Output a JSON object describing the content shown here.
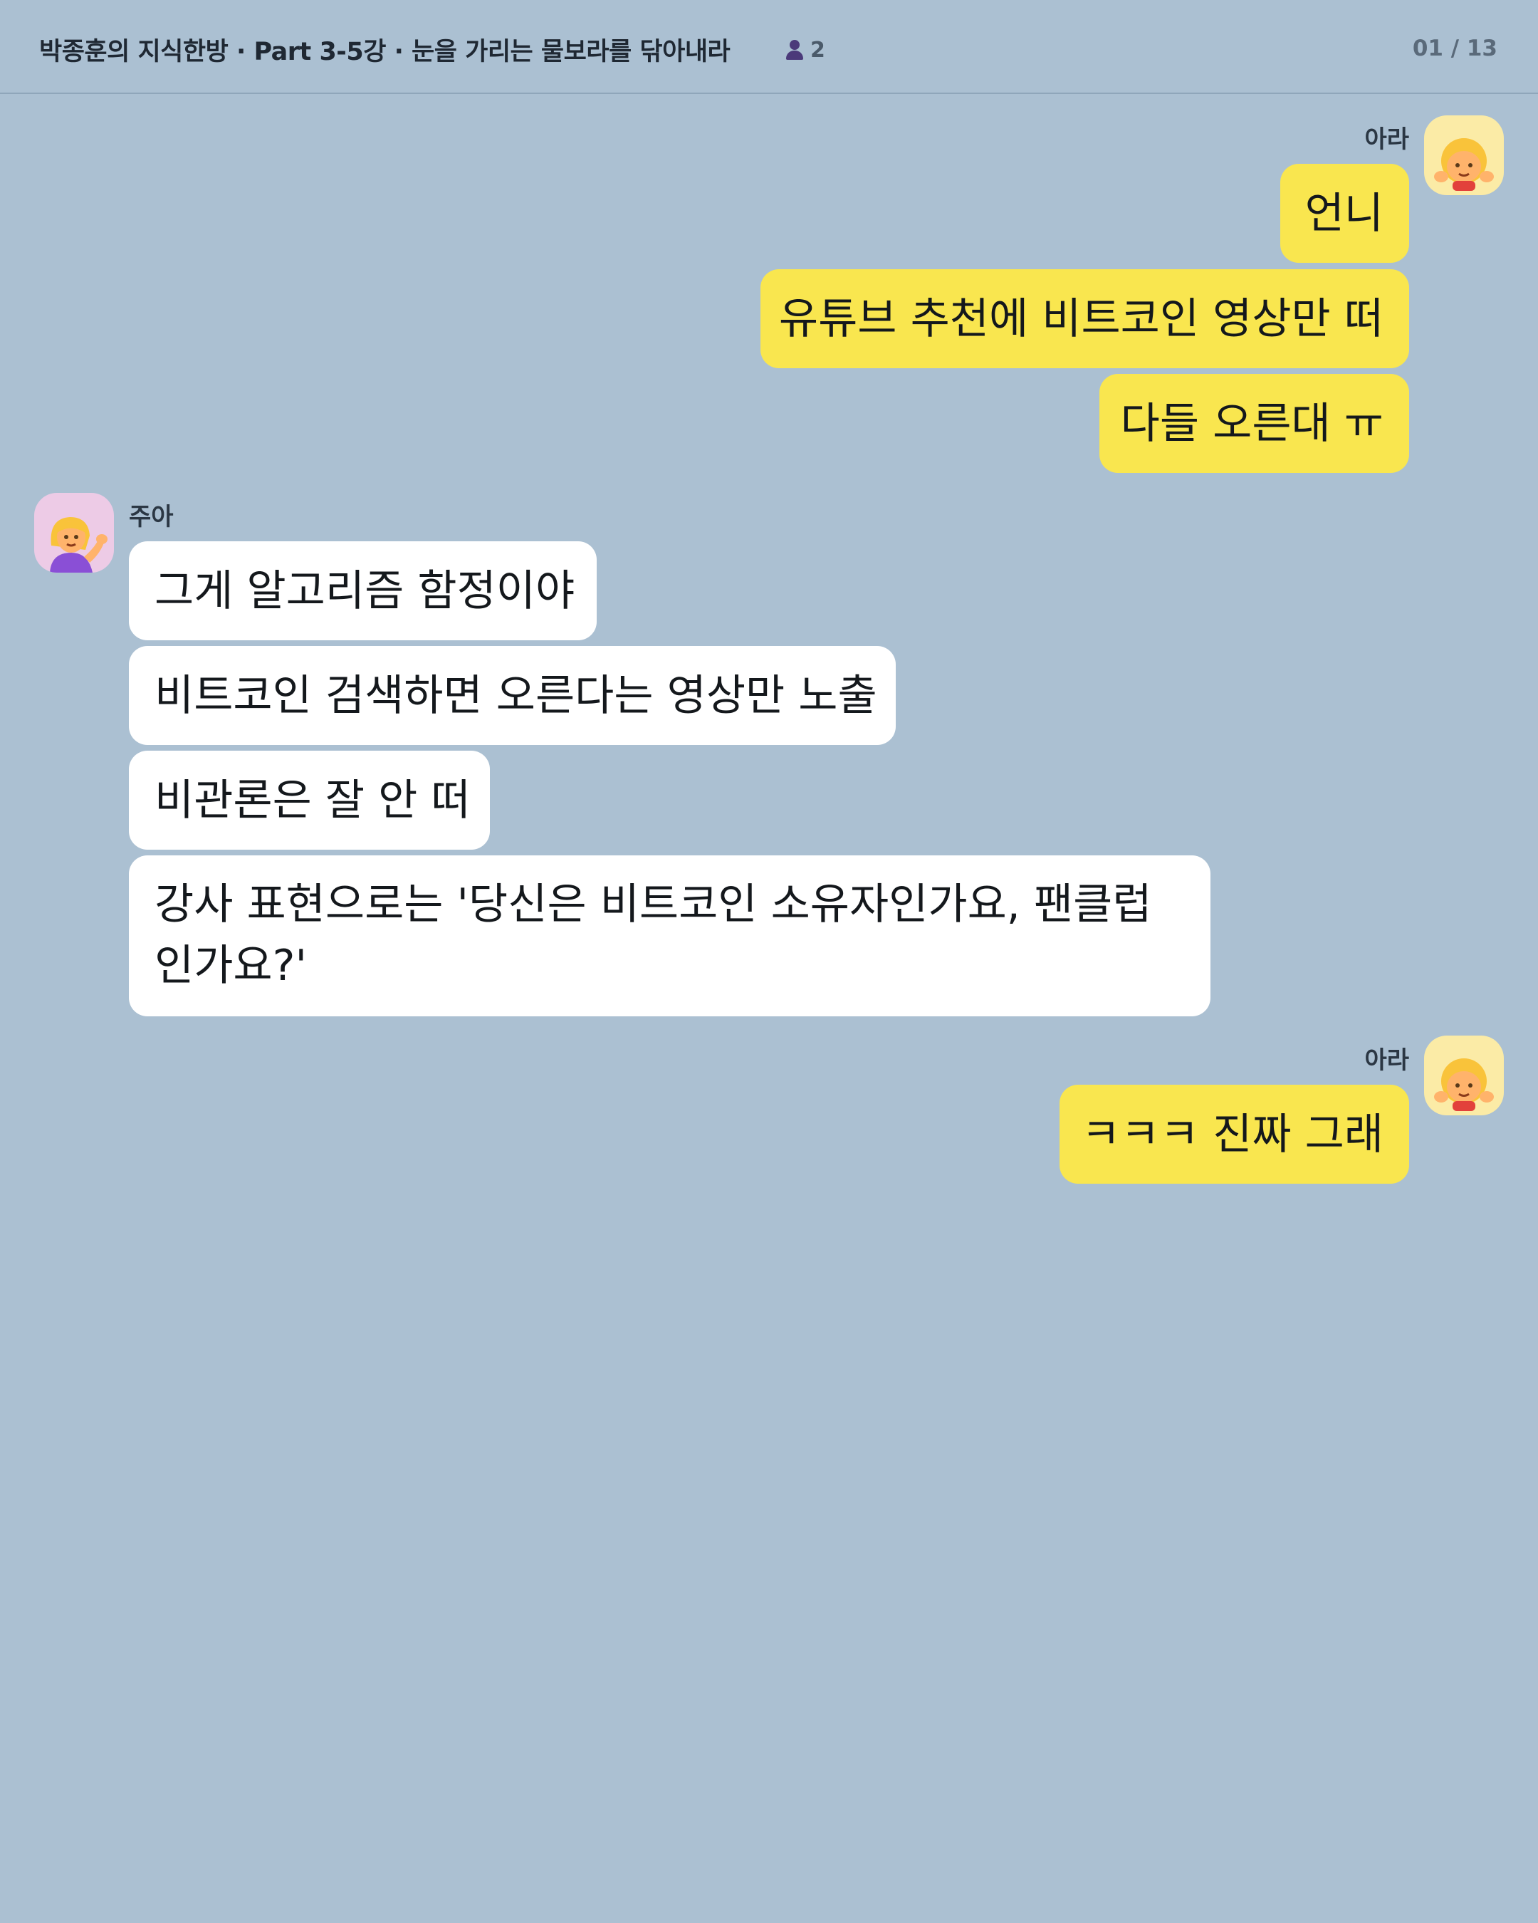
{
  "header": {
    "title": "박종훈의 지식한방 · Part 3-5강 · 눈을 가리는 물보라를 닦아내라",
    "member_count": "2",
    "member_icon": "person-icon",
    "page_counter": "01 / 13"
  },
  "colors": {
    "background": "#ABC0D2",
    "my_bubble": "#F9E64F",
    "other_bubble": "#FFFFFF",
    "ara_avatar_bg": "#FBEBA6",
    "jua_avatar_bg": "#EDCBE6"
  },
  "messages": [
    {
      "sender": "아라",
      "side": "right",
      "avatar_icon": "blonde-girl-emoji-icon",
      "bubbles": [
        "언니",
        "유튜브 추천에 비트코인 영상만 떠",
        "다들 오른대 ㅠ"
      ]
    },
    {
      "sender": "주아",
      "side": "left",
      "avatar_icon": "woman-tipping-hand-emoji-icon",
      "bubbles": [
        "그게 알고리즘 함정이야",
        "비트코인 검색하면 오른다는 영상만 노출",
        "비관론은 잘 안 떠",
        "강사 표현으로는 '당신은 비트코인 소유자인가요, 팬클럽인가요?'"
      ]
    },
    {
      "sender": "아라",
      "side": "right",
      "avatar_icon": "blonde-girl-emoji-icon",
      "bubbles": [
        "ㅋㅋㅋ 진짜 그래"
      ]
    }
  ]
}
